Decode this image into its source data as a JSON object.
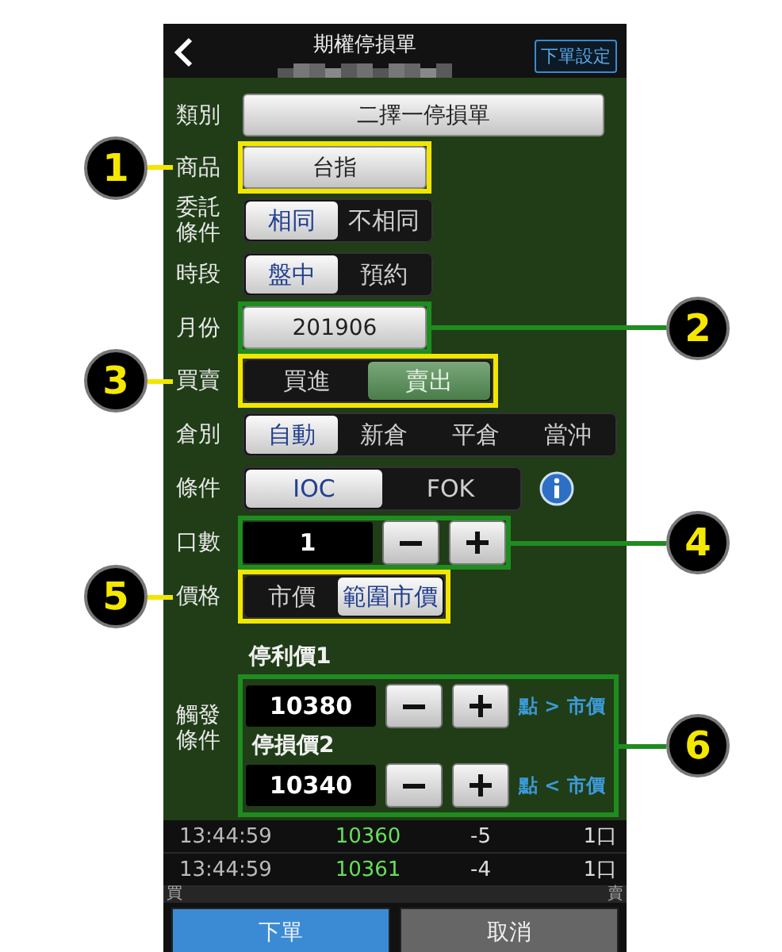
{
  "header": {
    "title": "期權停損單",
    "settings_button": "下單設定"
  },
  "form": [
    {
      "kind": "wide_button",
      "label": "類別",
      "value": "二擇一停損單"
    },
    {
      "kind": "button",
      "label": "商品",
      "value": "台指",
      "callout": {
        "number": "1",
        "color": "#f2e600"
      }
    },
    {
      "kind": "toggle",
      "label": "委託條件",
      "options": [
        {
          "label": "相同",
          "selected": true
        },
        {
          "label": "不相同",
          "selected": false
        }
      ]
    },
    {
      "kind": "toggle",
      "label": "時段",
      "options": [
        {
          "label": "盤中",
          "selected": true
        },
        {
          "label": "預約",
          "selected": false
        }
      ]
    },
    {
      "kind": "button",
      "label": "月份",
      "value": "201906",
      "callout": {
        "number": "2",
        "color": "#1f8c1f"
      }
    },
    {
      "kind": "side",
      "label": "買賣",
      "options": [
        {
          "label": "買進",
          "selected": false
        },
        {
          "label": "賣出",
          "selected": true
        }
      ],
      "callout": {
        "number": "3",
        "color": "#f2e600"
      }
    },
    {
      "kind": "toggle",
      "label": "倉別",
      "options": [
        {
          "label": "自動",
          "selected": true
        },
        {
          "label": "新倉",
          "selected": false
        },
        {
          "label": "平倉",
          "selected": false
        },
        {
          "label": "當沖",
          "selected": false
        }
      ]
    },
    {
      "kind": "wide_toggle",
      "label": "條件",
      "info": true,
      "options": [
        {
          "label": "IOC",
          "selected": true
        },
        {
          "label": "FOK",
          "selected": false
        }
      ]
    },
    {
      "kind": "stepper",
      "label": "口數",
      "value": "1",
      "callout": {
        "number": "4",
        "color": "#1f8c1f"
      }
    },
    {
      "kind": "toggle",
      "label": "價格",
      "options": [
        {
          "label": "市價",
          "selected": false
        },
        {
          "label": "範圍市價",
          "selected": true
        }
      ],
      "callout": {
        "number": "5",
        "color": "#f2e600"
      }
    },
    {
      "kind": "triggers",
      "label": "觸發條件",
      "items": [
        {
          "caption": "停利價1",
          "value": "10380",
          "note": "點 > 市價"
        },
        {
          "caption": "停損價2",
          "value": "10340",
          "note": "點 < 市價"
        }
      ],
      "callout": {
        "number": "6",
        "color": "#1f8c1f"
      }
    }
  ],
  "ticks": [
    {
      "time": "13:44:59",
      "price": "10360",
      "change": "-5",
      "qty": "1口"
    },
    {
      "time": "13:44:59",
      "price": "10361",
      "change": "-4",
      "qty": "1口"
    }
  ],
  "bottom_bar": {
    "left": "買",
    "right": "賣"
  },
  "buttons": [
    {
      "label": "下單",
      "kind": "primary"
    },
    {
      "label": "取消",
      "kind": "secondary"
    }
  ]
}
